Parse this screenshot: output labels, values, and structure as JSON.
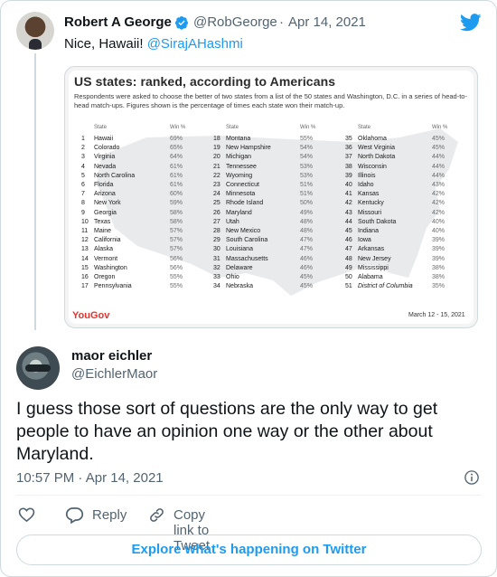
{
  "colors": {
    "accent": "#1d9bf0",
    "text": "#0f1419",
    "muted": "#536471",
    "yougov": "#e6322d"
  },
  "parent_tweet": {
    "name": "Robert A George",
    "handle": "@RobGeorge",
    "separator": "·",
    "date": "Apr 14, 2021",
    "text_prefix": "Nice, Hawaii! ",
    "mention": "@SirajAHashmi",
    "icons": {
      "verified": "verified-badge-icon",
      "logo": "twitter-bird-icon"
    }
  },
  "image": {
    "title": "US states: ranked, according to Americans",
    "subtitle": "Respondents were asked to choose the better of two states from a list of the 50 states and Washington, D.C. in a series of head-to-head match-ups. Figures shown is the percentage of times each state won their match-up.",
    "col_state": "State",
    "col_win": "Win %",
    "columns": [
      [
        {
          "rank": "1",
          "state": "Hawaii",
          "pct": "69%"
        },
        {
          "rank": "2",
          "state": "Colorado",
          "pct": "65%"
        },
        {
          "rank": "3",
          "state": "Virginia",
          "pct": "64%"
        },
        {
          "rank": "4",
          "state": "Nevada",
          "pct": "61%"
        },
        {
          "rank": "5",
          "state": "North Carolina",
          "pct": "61%"
        },
        {
          "rank": "6",
          "state": "Florida",
          "pct": "61%"
        },
        {
          "rank": "7",
          "state": "Arizona",
          "pct": "60%"
        },
        {
          "rank": "8",
          "state": "New York",
          "pct": "59%"
        },
        {
          "rank": "9",
          "state": "Georgia",
          "pct": "58%"
        },
        {
          "rank": "10",
          "state": "Texas",
          "pct": "58%"
        },
        {
          "rank": "11",
          "state": "Maine",
          "pct": "57%"
        },
        {
          "rank": "12",
          "state": "California",
          "pct": "57%"
        },
        {
          "rank": "13",
          "state": "Alaska",
          "pct": "57%"
        },
        {
          "rank": "14",
          "state": "Vermont",
          "pct": "56%"
        },
        {
          "rank": "15",
          "state": "Washington",
          "pct": "56%"
        },
        {
          "rank": "16",
          "state": "Oregon",
          "pct": "55%"
        },
        {
          "rank": "17",
          "state": "Pennsylvania",
          "pct": "55%"
        }
      ],
      [
        {
          "rank": "18",
          "state": "Montana",
          "pct": "55%"
        },
        {
          "rank": "19",
          "state": "New Hampshire",
          "pct": "54%"
        },
        {
          "rank": "20",
          "state": "Michigan",
          "pct": "54%"
        },
        {
          "rank": "21",
          "state": "Tennessee",
          "pct": "53%"
        },
        {
          "rank": "22",
          "state": "Wyoming",
          "pct": "53%"
        },
        {
          "rank": "23",
          "state": "Connecticut",
          "pct": "51%"
        },
        {
          "rank": "24",
          "state": "Minnesota",
          "pct": "51%"
        },
        {
          "rank": "25",
          "state": "Rhode Island",
          "pct": "50%"
        },
        {
          "rank": "26",
          "state": "Maryland",
          "pct": "49%"
        },
        {
          "rank": "27",
          "state": "Utah",
          "pct": "48%"
        },
        {
          "rank": "28",
          "state": "New Mexico",
          "pct": "48%"
        },
        {
          "rank": "29",
          "state": "South Carolina",
          "pct": "47%"
        },
        {
          "rank": "30",
          "state": "Louisiana",
          "pct": "47%"
        },
        {
          "rank": "31",
          "state": "Massachusetts",
          "pct": "46%"
        },
        {
          "rank": "32",
          "state": "Delaware",
          "pct": "46%"
        },
        {
          "rank": "33",
          "state": "Ohio",
          "pct": "45%"
        },
        {
          "rank": "34",
          "state": "Nebraska",
          "pct": "45%"
        }
      ],
      [
        {
          "rank": "35",
          "state": "Oklahoma",
          "pct": "45%"
        },
        {
          "rank": "36",
          "state": "West Virginia",
          "pct": "45%"
        },
        {
          "rank": "37",
          "state": "North Dakota",
          "pct": "44%"
        },
        {
          "rank": "38",
          "state": "Wisconsin",
          "pct": "44%"
        },
        {
          "rank": "39",
          "state": "Illinois",
          "pct": "44%"
        },
        {
          "rank": "40",
          "state": "Idaho",
          "pct": "43%"
        },
        {
          "rank": "41",
          "state": "Kansas",
          "pct": "42%"
        },
        {
          "rank": "42",
          "state": "Kentucky",
          "pct": "42%"
        },
        {
          "rank": "43",
          "state": "Missouri",
          "pct": "42%"
        },
        {
          "rank": "44",
          "state": "South Dakota",
          "pct": "40%"
        },
        {
          "rank": "45",
          "state": "Indiana",
          "pct": "40%"
        },
        {
          "rank": "46",
          "state": "Iowa",
          "pct": "39%"
        },
        {
          "rank": "47",
          "state": "Arkansas",
          "pct": "39%"
        },
        {
          "rank": "48",
          "state": "New Jersey",
          "pct": "39%"
        },
        {
          "rank": "49",
          "state": "Mississippi",
          "pct": "38%"
        },
        {
          "rank": "50",
          "state": "Alabama",
          "pct": "38%"
        },
        {
          "rank": "51",
          "state": "District of Columbia",
          "pct": "35%"
        }
      ]
    ],
    "brand": "YouGov",
    "date_range": "March 12 - 15, 2021"
  },
  "reply_tweet": {
    "name": "maor eichler",
    "handle": "@EichlerMaor",
    "text": "I guess those sort of questions are the only way to get people to have an opinion one way or the other about Maryland.",
    "time": "10:57 PM",
    "separator": "·",
    "date": "Apr 14, 2021",
    "icons": {
      "info": "info-icon"
    }
  },
  "actions": {
    "reply_label": "Reply",
    "copy_link_label": "Copy link to Tweet",
    "icons": [
      "heart-icon",
      "reply-icon",
      "link-icon"
    ]
  },
  "explore_label": "Explore what's happening on Twitter"
}
